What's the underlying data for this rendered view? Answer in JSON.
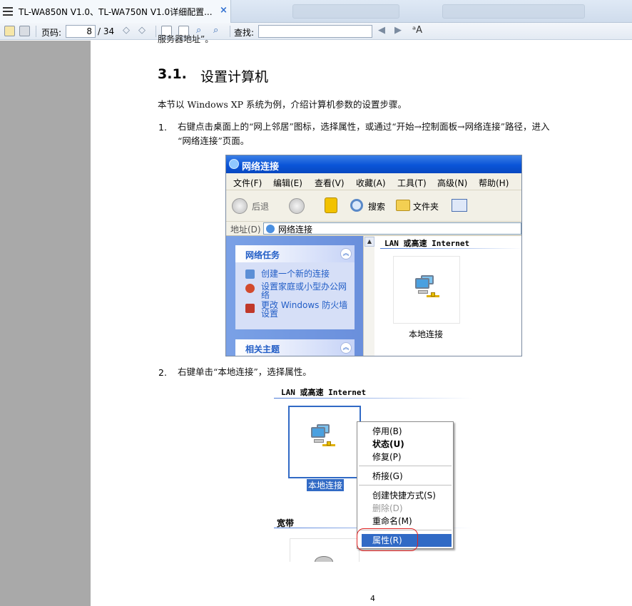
{
  "tab": {
    "title": "TL-WA850N  V1.0、TL-WA750N  V1.0详细配置...",
    "close": "×"
  },
  "toolbar": {
    "page_label": "页码:",
    "page_value": "8",
    "page_total": "/ 34",
    "find_label": "查找:",
    "find_value": ""
  },
  "doc": {
    "cut_line": "服务器地址”。",
    "heading_num": "3.1.",
    "heading_text": "设置计算机",
    "intro": "本节以 Windows XP 系统为例，介绍计算机参数的设置步骤。",
    "step1_num": "1.",
    "step1_line1": "右键点击桌面上的“网上邻居”图标，选择属性，或通过“开始→控制面板→网络连接”路径，进入",
    "step1_line2": "“网络连接”页面。",
    "step2_num": "2.",
    "step2_text": "右键单击“本地连接”，选择属性。",
    "page_number": "4"
  },
  "shot1": {
    "title": "网络连接",
    "menu": [
      "文件(F)",
      "编辑(E)",
      "查看(V)",
      "收藏(A)",
      "工具(T)",
      "高级(N)",
      "帮助(H)"
    ],
    "back_label": "后退",
    "search_label": "搜索",
    "folders_label": "文件夹",
    "address_label": "地址(D)",
    "address_value": "网络连接",
    "tasks_title": "网络任务",
    "task_links": [
      "创建一个新的连接",
      "设置家庭或小型办公网络",
      "更改 Windows 防火墙设置"
    ],
    "related_title": "相关主题",
    "group_head": "LAN 或高速 Internet",
    "item_label": "本地连接"
  },
  "shot2": {
    "group_head": "LAN 或高速 Internet",
    "item_label": "本地连接",
    "group2_head": "宽带",
    "menu": {
      "disable": "停用(B)",
      "status": "状态(U)",
      "repair": "修复(P)",
      "bridge": "桥接(G)",
      "shortcut": "创建快捷方式(S)",
      "delete": "删除(D)",
      "rename": "重命名(M)",
      "properties": "属性(R)"
    }
  }
}
